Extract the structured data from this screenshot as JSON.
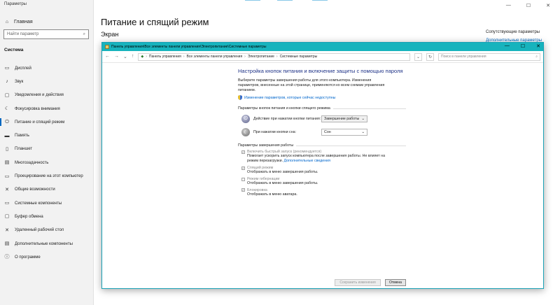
{
  "settings": {
    "window_title": "Параметры",
    "home": "Главная",
    "search_placeholder": "Найти параметр",
    "section": "Система",
    "nav": [
      {
        "label": "Дисплей",
        "icon": "display-icon",
        "glyph": "▭"
      },
      {
        "label": "Звук",
        "icon": "sound-icon",
        "glyph": "♪"
      },
      {
        "label": "Уведомления и действия",
        "icon": "notifications-icon",
        "glyph": "▢"
      },
      {
        "label": "Фокусировка внимания",
        "icon": "focus-moon-icon",
        "glyph": "☾"
      },
      {
        "label": "Питание и спящий режим",
        "icon": "power-icon",
        "glyph": "⏻"
      },
      {
        "label": "Память",
        "icon": "storage-icon",
        "glyph": "▬"
      },
      {
        "label": "Планшет",
        "icon": "tablet-icon",
        "glyph": "▯"
      },
      {
        "label": "Многозадачность",
        "icon": "multitasking-icon",
        "glyph": "▤"
      },
      {
        "label": "Проецирование на этот компьютер",
        "icon": "projecting-icon",
        "glyph": "▭"
      },
      {
        "label": "Общие возможности",
        "icon": "shared-experiences-icon",
        "glyph": "✕"
      },
      {
        "label": "Системные компоненты",
        "icon": "system-components-icon",
        "glyph": "▭"
      },
      {
        "label": "Буфер обмена",
        "icon": "clipboard-icon",
        "glyph": "▢"
      },
      {
        "label": "Удаленный рабочий стол",
        "icon": "remote-desktop-icon",
        "glyph": "✕"
      },
      {
        "label": "Дополнительные компоненты",
        "icon": "optional-features-icon",
        "glyph": "▤"
      },
      {
        "label": "О программе",
        "icon": "info-icon",
        "glyph": "ⓘ"
      }
    ],
    "active_index": 4,
    "page_title": "Питание и спящий режим",
    "subheading": "Экран",
    "related_link_1": "Сопутствующие параметры",
    "related_link_2": "Дополнительные параметры"
  },
  "control_panel": {
    "window_title": "Панель управления\\Все элементы панели управления\\Электропитание\\Системные параметры",
    "breadcrumbs": [
      "Панель управления",
      "Все элементы панели управления",
      "Электропитание",
      "Системные параметры"
    ],
    "search_placeholder": "Поиск в панели управления",
    "heading": "Настройка кнопок питания и включение защиты с помощью пароля",
    "description": "Выберите параметры завершения работы для этого компьютера. Изменения параметров, внесенные на этой странице, применяются ко всем схемам управления питанием.",
    "admin_link": "Изменение параметров, которые сейчас недоступны",
    "group1_title": "Параметры кнопок питания и кнопки спящего режима",
    "power_button_label": "Действие при нажатии кнопки питания:",
    "power_button_value": "Завершение работы",
    "sleep_button_label": "При нажатии кнопки сна:",
    "sleep_button_value": "Сон",
    "group2_title": "Параметры завершения работы",
    "fast_startup_label": "Включить быстрый запуск (рекомендуется)",
    "fast_startup_desc": "Помогает ускорить запуск компьютера после завершения работы. Не влияет на режим перезагрузки.",
    "fast_startup_link": "Дополнительные сведения",
    "sleep_label": "Спящий режим",
    "sleep_desc": "Отображать в меню завершения работы.",
    "hibernate_label": "Режим гибернации",
    "hibernate_desc": "Отображать в меню завершения работы.",
    "lock_label": "Блокировка",
    "lock_desc": "Отображать в меню аватара.",
    "save_button": "Сохранить изменения",
    "cancel_button": "Отмена"
  }
}
